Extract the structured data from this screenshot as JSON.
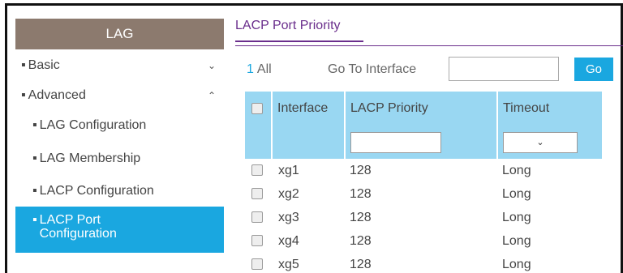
{
  "sidebar": {
    "title": "LAG",
    "items": [
      {
        "label": "Basic",
        "chevron": "chevron-down-icon"
      },
      {
        "label": "Advanced",
        "chevron": "chevron-up-icon"
      }
    ],
    "subitems": [
      {
        "label": "LAG Configuration"
      },
      {
        "label": "LAG Membership"
      },
      {
        "label": "LACP Configuration"
      },
      {
        "label": "LACP Port Configuration",
        "active": true
      }
    ],
    "active_color": "#1aa7e0",
    "header_color": "#8c7a6e"
  },
  "main": {
    "tab_label": "LACP Port Priority",
    "pager": {
      "page": "1",
      "all_label": "All"
    },
    "goto_label": "Go To Interface",
    "goto_value": "",
    "go_button": "Go",
    "table": {
      "headers": [
        "Interface",
        "LACP Priority",
        "Timeout"
      ],
      "filter": {
        "priority": "",
        "timeout": ""
      },
      "rows": [
        {
          "interface": "xg1",
          "priority": "128",
          "timeout": "Long"
        },
        {
          "interface": "xg2",
          "priority": "128",
          "timeout": "Long"
        },
        {
          "interface": "xg3",
          "priority": "128",
          "timeout": "Long"
        },
        {
          "interface": "xg4",
          "priority": "128",
          "timeout": "Long"
        },
        {
          "interface": "xg5",
          "priority": "128",
          "timeout": "Long"
        }
      ]
    }
  },
  "colors": {
    "accent": "#1aa7e0",
    "tab": "#6a2e8c",
    "table_header": "#99d7f2"
  }
}
